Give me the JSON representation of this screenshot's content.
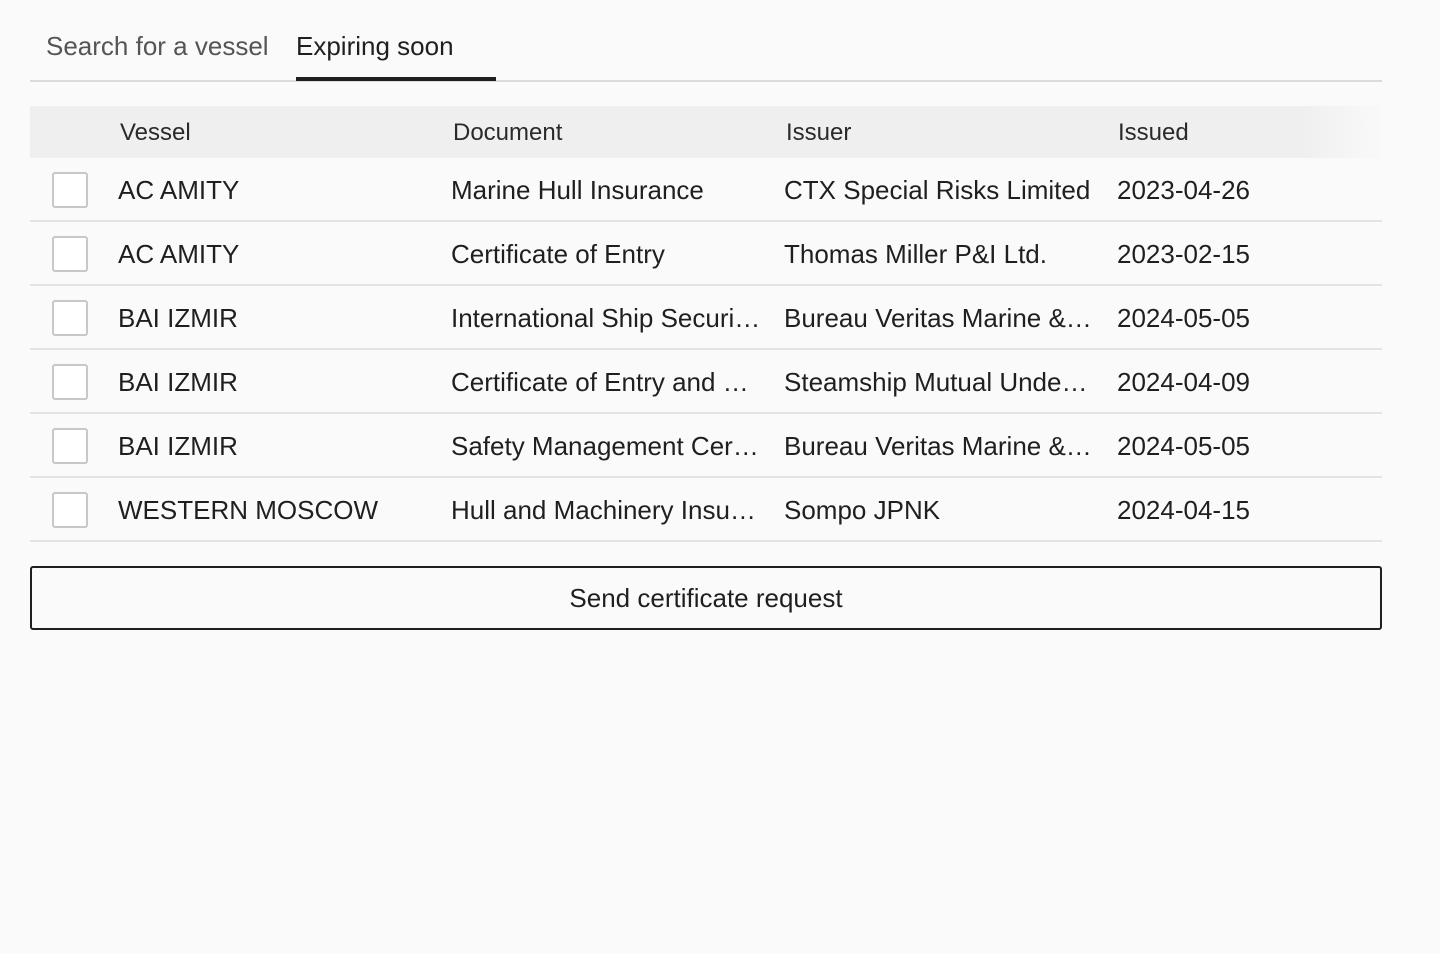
{
  "tabs": {
    "search_label": "Search for a vessel",
    "expiring_label": "Expiring soon",
    "active": "Expiring soon"
  },
  "table": {
    "headers": {
      "vessel": "Vessel",
      "document": "Document",
      "issuer": "Issuer",
      "issued": "Issued"
    },
    "rows": [
      {
        "vessel": "AC AMITY",
        "document": "Marine Hull Insurance",
        "issuer": "CTX Special Risks Limited",
        "issued": "2023-04-26",
        "checked": false
      },
      {
        "vessel": "AC AMITY",
        "document": "Certificate of Entry",
        "issuer": "Thomas Miller P&I Ltd.",
        "issued": "2023-02-15",
        "checked": false
      },
      {
        "vessel": "BAI IZMIR",
        "document": "International Ship Securi…",
        "issuer": "Bureau Veritas Marine &…",
        "issued": "2024-05-05",
        "checked": false
      },
      {
        "vessel": "BAI IZMIR",
        "document": "Certificate of Entry and …",
        "issuer": "Steamship Mutual Unde…",
        "issued": "2024-04-09",
        "checked": false
      },
      {
        "vessel": "BAI IZMIR",
        "document": "Safety Management Cer…",
        "issuer": "Bureau Veritas Marine &…",
        "issued": "2024-05-05",
        "checked": false
      },
      {
        "vessel": "WESTERN MOSCOW",
        "document": "Hull and Machinery Insu…",
        "issuer": "Sompo JPNK",
        "issued": "2024-04-15",
        "checked": false
      }
    ]
  },
  "actions": {
    "send_label": "Send certificate request"
  }
}
